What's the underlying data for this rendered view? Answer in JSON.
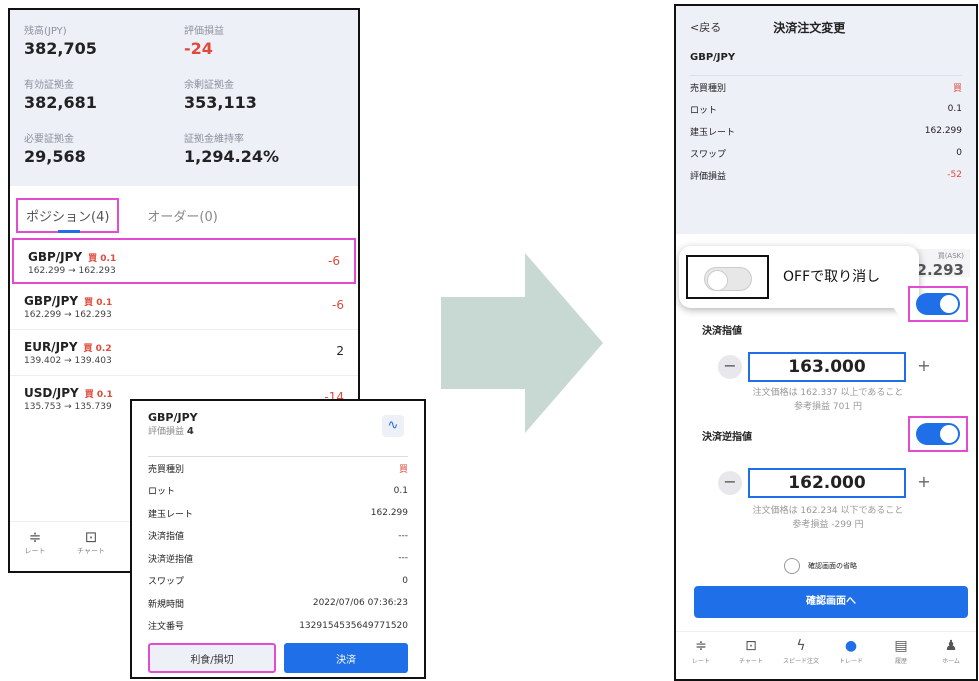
{
  "left": {
    "account": [
      {
        "label": "残高(JPY)",
        "value": "382,705",
        "red": false
      },
      {
        "label": "評価損益",
        "value": "-24",
        "red": true
      },
      {
        "label": "有効証拠金",
        "value": "382,681",
        "red": false
      },
      {
        "label": "余剰証拠金",
        "value": "353,113",
        "red": false
      },
      {
        "label": "必要証拠金",
        "value": "29,568",
        "red": false
      },
      {
        "label": "証拠金維持率",
        "value": "1,294.24%",
        "red": false
      }
    ],
    "tabs": {
      "positions": "ポジション(4)",
      "orders": "オーダー(0)"
    },
    "positions": [
      {
        "pair": "GBP/JPY",
        "side": "買 0.1",
        "rate": "162.299 → 162.293",
        "pl": "-6"
      },
      {
        "pair": "GBP/JPY",
        "side": "買 0.1",
        "rate": "162.299 → 162.293",
        "pl": "-6"
      },
      {
        "pair": "EUR/JPY",
        "side": "買 0.2",
        "rate": "139.402 → 139.403",
        "pl": "2"
      },
      {
        "pair": "USD/JPY",
        "side": "買 0.1",
        "rate": "135.753 → 135.739",
        "pl": "-14"
      }
    ],
    "nav": [
      {
        "icon": "rate-icon",
        "label": "レート"
      },
      {
        "icon": "chart-icon",
        "label": "チャート"
      }
    ]
  },
  "popup": {
    "pair": "GBP/JPY",
    "pl_label": "評価損益",
    "pl_value": "4",
    "rows": [
      {
        "k": "売買種別",
        "v": "買"
      },
      {
        "k": "ロット",
        "v": "0.1"
      },
      {
        "k": "建玉レート",
        "v": "162.299"
      },
      {
        "k": "決済指値",
        "v": "---"
      },
      {
        "k": "決済逆指値",
        "v": "---"
      },
      {
        "k": "スワップ",
        "v": "0"
      },
      {
        "k": "新規時間",
        "v": "2022/07/06 07:36:23"
      },
      {
        "k": "注文番号",
        "v": "1329154535649771520"
      }
    ],
    "btn_limit": "利食/損切",
    "btn_settle": "決済"
  },
  "right": {
    "back": "<戻る",
    "title": "決済注文変更",
    "pair": "GBP/JPY",
    "rows": [
      {
        "k": "売買種別",
        "v": "買"
      },
      {
        "k": "ロット",
        "v": "0.1"
      },
      {
        "k": "建玉レート",
        "v": "162.299"
      },
      {
        "k": "スワップ",
        "v": "0"
      },
      {
        "k": "評価損益",
        "v": "-52"
      }
    ],
    "ask_label": "買(ASK)",
    "ask_value": "52.293",
    "tooltip": "OFFで取り消し",
    "limit_label": "決済指値",
    "limit_value": "163.000",
    "limit_note1": "注文価格は 162.337 以上であること",
    "limit_note2": "参考損益 701 円",
    "stop_label": "決済逆指値",
    "stop_value": "162.000",
    "stop_note1": "注文価格は 162.234 以下であること",
    "stop_note2": "参考損益 -299 円",
    "skip_confirm": "確認画面の省略",
    "confirm_btn": "確認画面へ",
    "nav": [
      {
        "icon": "rate-icon",
        "label": "レート"
      },
      {
        "icon": "chart-icon",
        "label": "チャート"
      },
      {
        "icon": "speed-order-icon",
        "label": "スピード注文"
      },
      {
        "icon": "trade-icon",
        "label": "トレード"
      },
      {
        "icon": "history-icon",
        "label": "履歴"
      },
      {
        "icon": "home-icon",
        "label": "ホーム"
      }
    ]
  },
  "colors": {
    "accent": "#1f6fe8",
    "loss": "#e04a3a",
    "highlight": "#e34bd1",
    "arrow": "#c8d8d2"
  }
}
